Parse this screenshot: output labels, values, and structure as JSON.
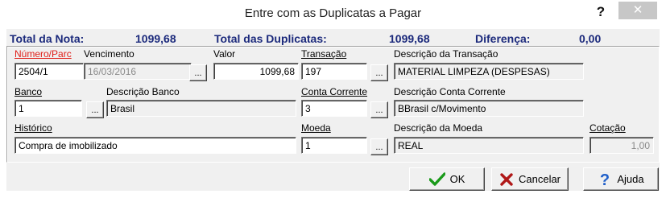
{
  "window": {
    "title": "Entre com as Duplicatas a Pagar",
    "help_glyph": "?",
    "close_glyph": "✕"
  },
  "summary": {
    "total_nota_label": "Total da Nota:",
    "total_nota_value": "1099,68",
    "total_duplicatas_label": "Total das Duplicatas:",
    "total_duplicatas_value": "1099,68",
    "diferenca_label": "Diferença:",
    "diferenca_value": "0,00"
  },
  "labels": {
    "numero_parc": "Número/Parc",
    "vencimento": "Vencimento",
    "valor": "Valor",
    "transacao": "Transação",
    "descricao_transacao": "Descrição da Transação",
    "banco": "Banco",
    "descricao_banco": "Descrição Banco",
    "conta_corrente": "Conta Corrente",
    "descricao_conta_corrente": "Descrição Conta Corrente",
    "historico": "Histórico",
    "moeda": "Moeda",
    "descricao_moeda": "Descrição da Moeda",
    "cotacao": "Cotação"
  },
  "fields": {
    "numero_parc": "2504/1",
    "vencimento": "16/03/2016",
    "valor": "1099,68",
    "transacao": "197",
    "descricao_transacao": "MATERIAL LIMPEZA (DESPESAS)",
    "banco": "1",
    "descricao_banco": "Brasil",
    "conta_corrente": "3",
    "descricao_conta_corrente": "BBrasil c/Movimento",
    "historico": "Compra de imobilizado",
    "moeda": "1",
    "descricao_moeda": "REAL",
    "cotacao": "1,00"
  },
  "ellipsis": "...",
  "buttons": {
    "ok": "OK",
    "cancelar": "Cancelar",
    "ajuda": "Ajuda"
  },
  "colors": {
    "summary_text": "#1c2a7c",
    "required_label": "#e0201a",
    "ok_icon": "#1a9a1a",
    "cancel_icon": "#b01818",
    "help_icon": "#1f5fc9"
  }
}
